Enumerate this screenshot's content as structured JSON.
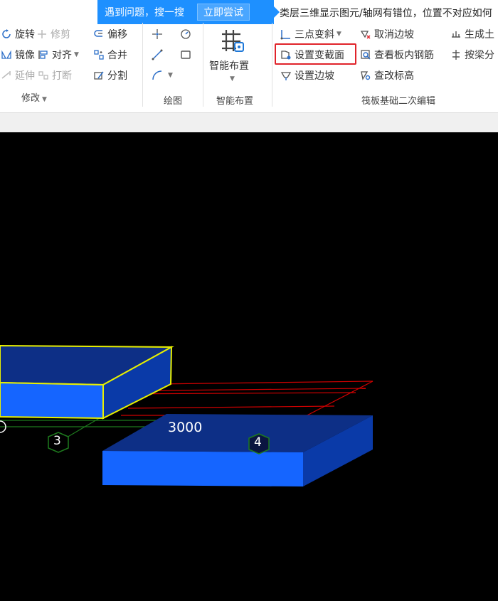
{
  "tip": {
    "text": "遇到问题，搜一搜",
    "button": "立即尝试"
  },
  "search": {
    "text": "类层三维显示图元/轴网有错位，位置不对应如何"
  },
  "ribbon": {
    "modify": {
      "rotate": "旋转",
      "trim": "修剪",
      "offset": "偏移",
      "mirror": "镜像",
      "align": "对齐",
      "merge": "合并",
      "extend": "延伸",
      "break": "打断",
      "split": "分割",
      "label": "修改"
    },
    "draw": {
      "label": "绘图"
    },
    "smart": {
      "button": "智能布置",
      "label": "智能布置"
    },
    "raft": {
      "three_point_slope": "三点变斜",
      "cancel_slope": "取消边坡",
      "generate_soil": "生成土",
      "set_section": "设置变截面",
      "view_rebar": "查看板内钢筋",
      "by_beam": "按梁分",
      "set_slope": "设置边坡",
      "view_elevation": "查改标高",
      "label": "筏板基础二次编辑"
    }
  },
  "viewport": {
    "dimension": "3000",
    "axis_labels": [
      "3",
      "4"
    ],
    "colors": {
      "slab": "#1565ff",
      "slab_dark": "#0a3aa8",
      "outline": "#e8f000",
      "grid_red": "#d00000",
      "grid_green": "#1e7a1e"
    }
  }
}
